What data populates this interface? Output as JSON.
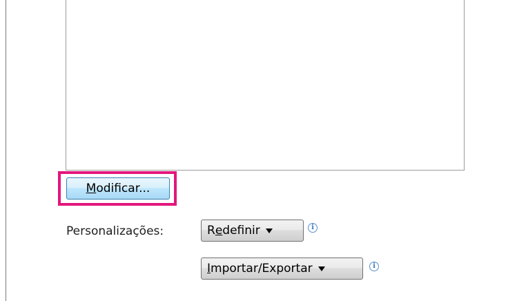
{
  "modify_button": {
    "prefix": "",
    "accel": "M",
    "rest": "odificar..."
  },
  "customizations": {
    "label": "Personalizações:",
    "reset_button": {
      "accel_prefix": "R",
      "accel": "e",
      "rest": "definir"
    },
    "import_export_button": {
      "accel": "I",
      "rest": "mportar/Exportar"
    }
  },
  "icons": {
    "dropdown": "chevron-down-icon",
    "info": "info-icon"
  },
  "colors": {
    "highlight": "#e3167b",
    "primary_button_border": "#3c7fb1",
    "info_icon": "#3b78c0"
  }
}
